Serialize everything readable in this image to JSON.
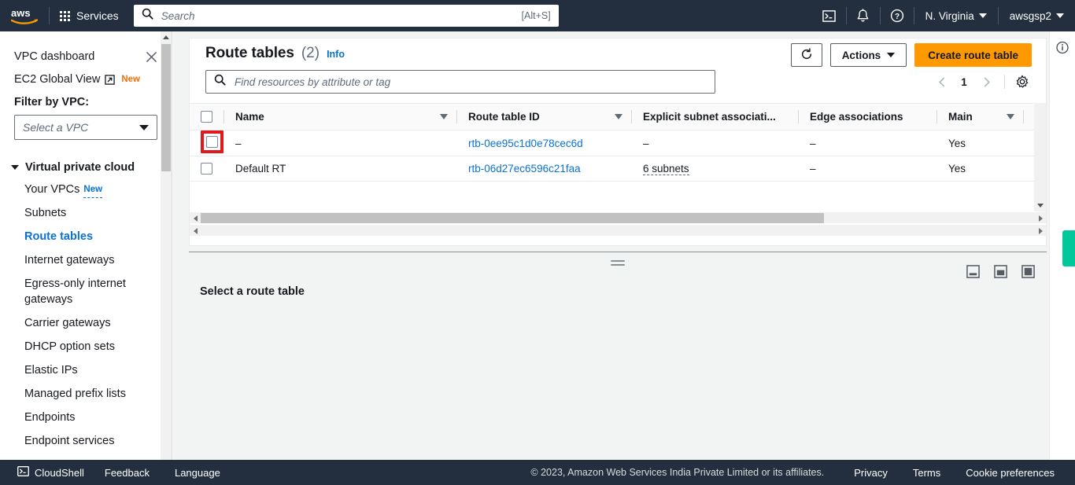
{
  "topnav": {
    "logo_alt": "aws",
    "services_label": "Services",
    "search_placeholder": "Search",
    "search_value": "",
    "search_shortcut": "[Alt+S]",
    "cloudshell_icon": "cloudshell-icon",
    "notifications_icon": "bell-icon",
    "help_icon": "question-circle-icon",
    "region_label": "N. Virginia",
    "account_label": "awsgsp2"
  },
  "sidebar": {
    "dashboard_label": "VPC dashboard",
    "close_icon": "close-icon",
    "ec2_global_view_label": "EC2 Global View",
    "ec2_global_view_badge": "New",
    "external_link_icon": "external-link-icon",
    "filter_label": "Filter by VPC:",
    "vpc_select_placeholder": "Select a VPC",
    "group_label": "Virtual private cloud",
    "items": [
      {
        "label": "Your VPCs",
        "badge": "New",
        "active": false
      },
      {
        "label": "Subnets",
        "badge": "",
        "active": false
      },
      {
        "label": "Route tables",
        "badge": "",
        "active": true
      },
      {
        "label": "Internet gateways",
        "badge": "",
        "active": false
      },
      {
        "label": "Egress-only internet gateways",
        "badge": "",
        "active": false
      },
      {
        "label": "Carrier gateways",
        "badge": "",
        "active": false
      },
      {
        "label": "DHCP option sets",
        "badge": "",
        "active": false
      },
      {
        "label": "Elastic IPs",
        "badge": "",
        "active": false
      },
      {
        "label": "Managed prefix lists",
        "badge": "",
        "active": false
      },
      {
        "label": "Endpoints",
        "badge": "",
        "active": false
      },
      {
        "label": "Endpoint services",
        "badge": "",
        "active": false
      }
    ]
  },
  "main": {
    "title": "Route tables",
    "count": "(2)",
    "info_label": "Info",
    "refresh_icon": "refresh-icon",
    "actions_label": "Actions",
    "create_label": "Create route table",
    "filter_placeholder": "Find resources by attribute or tag",
    "filter_value": "",
    "search_icon": "search-icon",
    "pagination": {
      "prev_icon": "chevron-left-icon",
      "page": "1",
      "next_icon": "chevron-right-icon",
      "settings_icon": "gear-icon"
    },
    "table": {
      "select_all_name": "select-all-checkbox",
      "columns": [
        {
          "key": "name",
          "label": "Name",
          "sortable": true
        },
        {
          "key": "rtid",
          "label": "Route table ID",
          "sortable": true
        },
        {
          "key": "esa",
          "label": "Explicit subnet associati...",
          "sortable": false
        },
        {
          "key": "edge",
          "label": "Edge associations",
          "sortable": false
        },
        {
          "key": "main",
          "label": "Main",
          "sortable": true
        }
      ],
      "rows": [
        {
          "selected": false,
          "highlighted": true,
          "name": "–",
          "route_table_id": "rtb-0ee95c1d0e78cec6d",
          "explicit_subnet_associations": "–",
          "edge_associations": "–",
          "main": "Yes"
        },
        {
          "selected": false,
          "highlighted": false,
          "name": "Default RT",
          "route_table_id": "rtb-06d27ec6596c21faa",
          "explicit_subnet_associations": "6 subnets",
          "edge_associations": "–",
          "main": "Yes"
        }
      ]
    }
  },
  "split_panel": {
    "title": "Select a route table",
    "resize_handle": "resize-handle",
    "preference_icons": [
      "panel-size-small-icon",
      "panel-size-medium-icon",
      "panel-size-large-icon"
    ]
  },
  "right_rail": {
    "info_icon": "info-circle-icon",
    "feedback_tab": "feedback-tab",
    "feedback_color": "#00c89a"
  },
  "footer": {
    "cloudshell_label": "CloudShell",
    "cloudshell_icon": "cloudshell-icon",
    "feedback_label": "Feedback",
    "language_label": "Language",
    "copyright": "© 2023, Amazon Web Services India Private Limited or its affiliates.",
    "privacy_label": "Privacy",
    "terms_label": "Terms",
    "cookie_label": "Cookie preferences"
  },
  "colors": {
    "nav_bg": "#232f3e",
    "primary_orange": "#ff9900",
    "link_blue": "#0972d3",
    "highlight_red": "#e01a1a",
    "feedback_green": "#00c89a"
  }
}
